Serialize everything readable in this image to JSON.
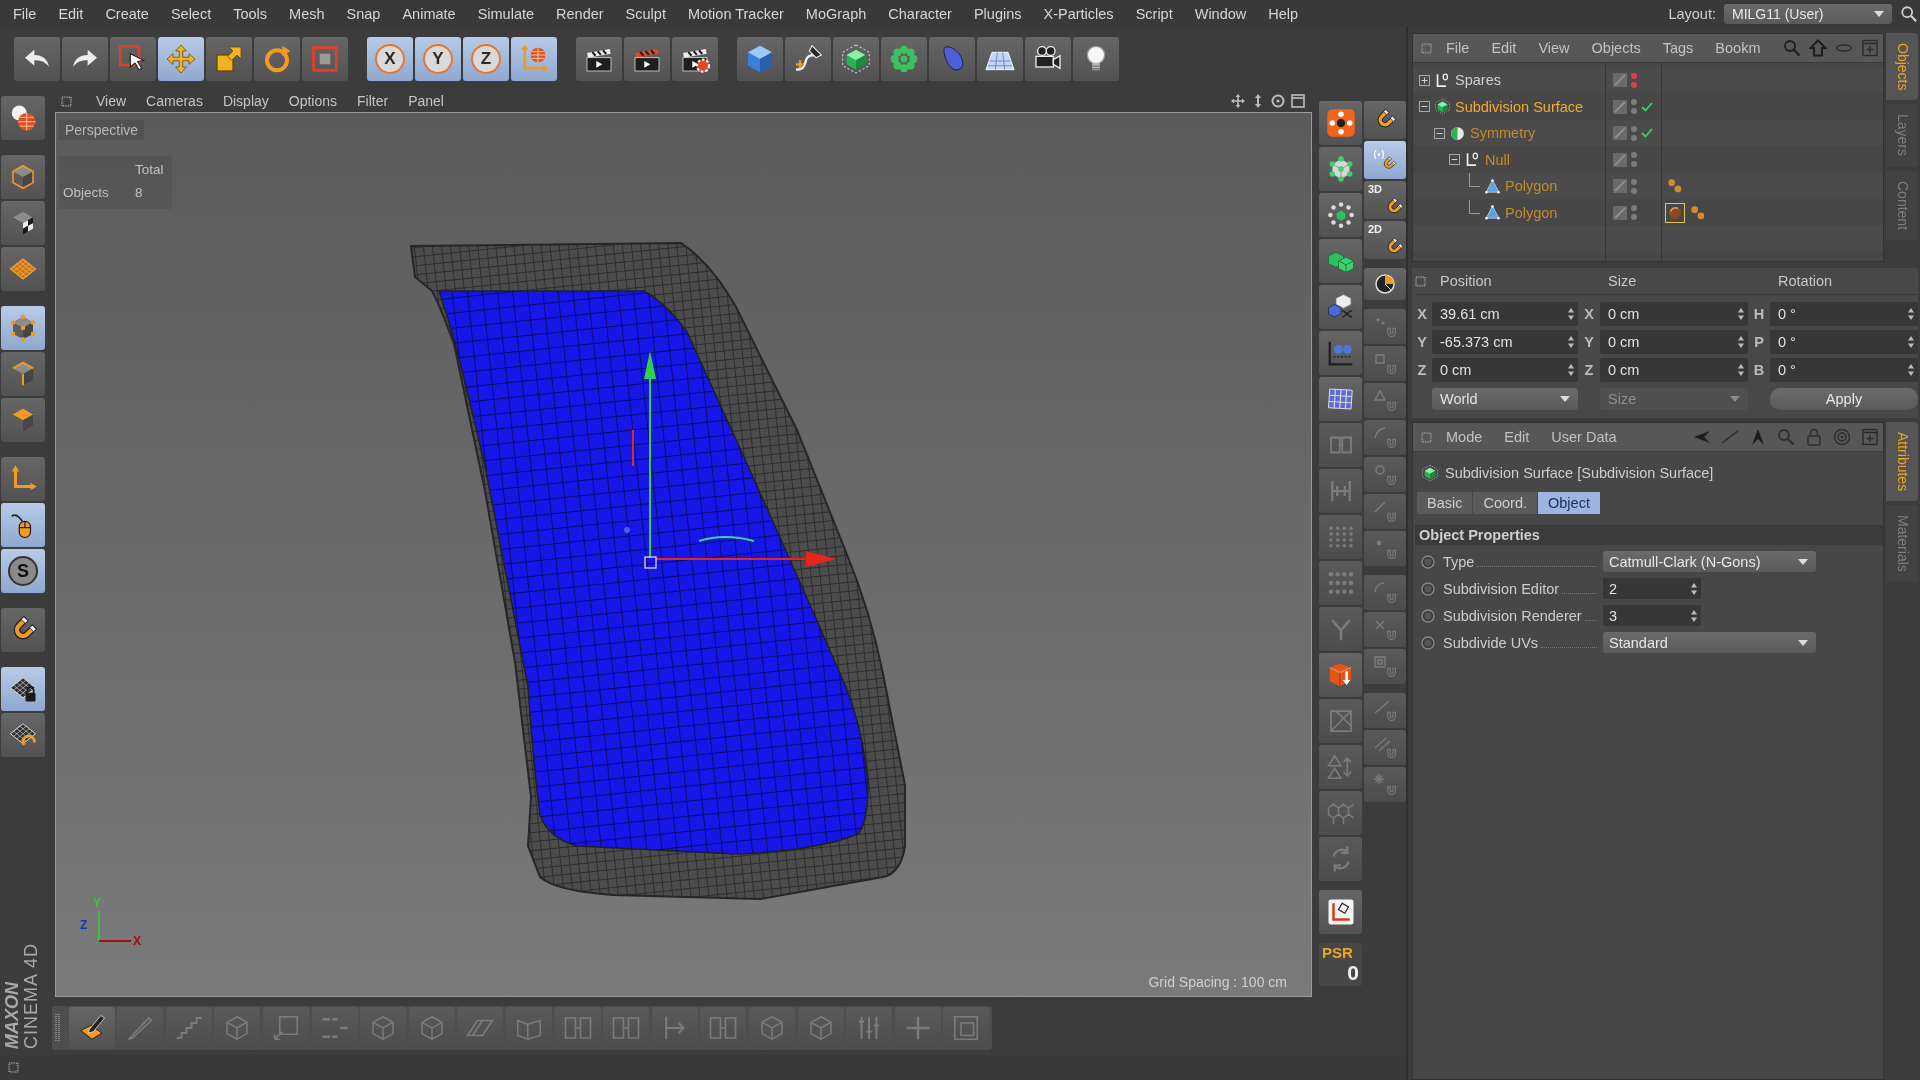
{
  "menu_bar": {
    "items": [
      "File",
      "Edit",
      "Create",
      "Select",
      "Tools",
      "Mesh",
      "Snap",
      "Animate",
      "Simulate",
      "Render",
      "Sculpt",
      "Motion Tracker",
      "MoGraph",
      "Character",
      "Plugins",
      "X-Particles",
      "Script",
      "Window",
      "Help"
    ],
    "layout_label": "Layout:",
    "layout_value": "MILG11 (User)"
  },
  "toolbar": {
    "groups": [
      [
        {
          "kind": "undo",
          "active": false
        },
        {
          "kind": "redo",
          "active": false
        },
        {
          "kind": "select",
          "active": false
        },
        {
          "kind": "move",
          "active": true
        },
        {
          "kind": "scale",
          "active": false
        },
        {
          "kind": "rotate",
          "active": false
        },
        {
          "kind": "recent",
          "active": false
        }
      ],
      [
        {
          "kind": "lock",
          "label": "X",
          "active": true
        },
        {
          "kind": "lock",
          "label": "Y",
          "active": true
        },
        {
          "kind": "lock",
          "label": "Z",
          "active": true
        },
        {
          "kind": "world",
          "active": true
        }
      ],
      [
        {
          "kind": "clapper",
          "active": false
        },
        {
          "kind": "render",
          "active": false
        },
        {
          "kind": "settings",
          "active": false
        }
      ],
      [
        {
          "kind": "cube",
          "active": false
        },
        {
          "kind": "pen",
          "active": false
        },
        {
          "kind": "subdivision",
          "active": false
        },
        {
          "kind": "cloner",
          "active": false
        },
        {
          "kind": "bend",
          "active": false
        },
        {
          "kind": "floor",
          "active": false
        },
        {
          "kind": "camera",
          "active": false
        },
        {
          "kind": "light",
          "active": false
        }
      ]
    ]
  },
  "mode_palette": {
    "groups": [
      [
        {
          "kind": "globe",
          "active": false
        }
      ],
      [
        {
          "kind": "model",
          "active": false
        },
        {
          "kind": "texture",
          "active": false
        },
        {
          "kind": "workplane",
          "active": false
        }
      ],
      [
        {
          "kind": "points",
          "active": true
        },
        {
          "kind": "edges",
          "active": false
        },
        {
          "kind": "polygons",
          "active": false
        }
      ],
      [
        {
          "kind": "axis",
          "active": false
        },
        {
          "kind": "tweak",
          "active": true
        },
        {
          "kind": "solo",
          "label": "S",
          "active": true
        }
      ],
      [
        {
          "kind": "magnet",
          "active": false
        }
      ],
      [
        {
          "kind": "gridlock",
          "active": true
        },
        {
          "kind": "gridrotate",
          "active": false
        }
      ]
    ]
  },
  "brand": {
    "maker": "MAXON",
    "product": "CINEMA 4D"
  },
  "viewport": {
    "menu": [
      "View",
      "Cameras",
      "Display",
      "Options",
      "Filter",
      "Panel"
    ],
    "camera": "Perspective",
    "stats": {
      "header": "Total",
      "rows": [
        {
          "label": "Objects",
          "value": "8"
        }
      ]
    },
    "axes": [
      {
        "label": "Y",
        "color": "#3fbf3f"
      },
      {
        "label": "Z",
        "color": "#1e2ec8"
      },
      {
        "label": "X",
        "color": "#a01010"
      }
    ],
    "grid_spacing": "Grid Spacing : 100 cm"
  },
  "snap_palette": {
    "column_1": {
      "groups": [
        [
          {
            "kind": "crosshair",
            "disabled": false
          },
          {
            "kind": "cubedots",
            "disabled": false
          },
          {
            "kind": "scatter",
            "disabled": false
          },
          {
            "kind": "cubes",
            "disabled": false
          },
          {
            "kind": "shuffle",
            "disabled": false
          },
          {
            "kind": "chart",
            "disabled": false
          },
          {
            "kind": "grid",
            "disabled": false
          },
          {
            "kind": "split",
            "disabled": true
          },
          {
            "kind": "hbars",
            "disabled": true
          },
          {
            "kind": "dots",
            "disabled": true
          },
          {
            "kind": "dotrows",
            "disabled": true
          },
          {
            "kind": "branch",
            "disabled": true
          },
          {
            "kind": "boxarrow",
            "disabled": false
          },
          {
            "kind": "slashbox",
            "disabled": true
          },
          {
            "kind": "triangles",
            "disabled": true
          },
          {
            "kind": "mesh",
            "disabled": true
          },
          {
            "kind": "recycle",
            "disabled": true
          }
        ],
        [
          {
            "kind": "axes",
            "disabled": false
          }
        ]
      ]
    },
    "psr": {
      "label": "PSR",
      "value": "0"
    },
    "column_2": {
      "groups": [
        [
          {
            "kind": "magnet",
            "active": false,
            "disabled": false
          },
          {
            "kind": "magnetdot",
            "active": true,
            "disabled": false
          },
          {
            "kind": "magnet",
            "label": "3D",
            "active": false,
            "disabled": false
          },
          {
            "kind": "magnet",
            "label": "2D",
            "active": false,
            "disabled": false
          }
        ],
        [
          {
            "kind": "pie",
            "active": false,
            "disabled": false
          }
        ],
        [
          {
            "kind": "snapdots",
            "active": false,
            "disabled": true
          },
          {
            "kind": "snapsquare",
            "active": false,
            "disabled": true
          },
          {
            "kind": "snaptri",
            "active": false,
            "disabled": true
          },
          {
            "kind": "snapcurve",
            "active": false,
            "disabled": true
          },
          {
            "kind": "snapring",
            "active": false,
            "disabled": true
          },
          {
            "kind": "snapslash",
            "active": false,
            "disabled": true
          },
          {
            "kind": "snappoint",
            "active": false,
            "disabled": true
          }
        ],
        [
          {
            "kind": "snaparc",
            "active": false,
            "disabled": true
          },
          {
            "kind": "snapcross",
            "active": false,
            "disabled": true
          },
          {
            "kind": "snapframe",
            "active": false,
            "disabled": true
          }
        ],
        [
          {
            "kind": "snapline",
            "active": false,
            "disabled": true
          },
          {
            "kind": "snaplines",
            "active": false,
            "disabled": true
          },
          {
            "kind": "snapstar",
            "active": false,
            "disabled": true
          }
        ]
      ]
    }
  },
  "bottom_toolbar": {
    "items": [
      {
        "kind": "draw",
        "disabled": false
      },
      {
        "kind": "knife",
        "disabled": true
      },
      {
        "kind": "stairs",
        "disabled": true
      },
      {
        "kind": "box",
        "disabled": true
      },
      {
        "kind": "squarearrows",
        "disabled": true
      },
      {
        "kind": "dashes",
        "disabled": true
      },
      {
        "kind": "box",
        "disabled": true
      },
      {
        "kind": "box",
        "disabled": true
      },
      {
        "kind": "flat",
        "disabled": true
      },
      {
        "kind": "fold",
        "disabled": true
      },
      {
        "kind": "bridge",
        "disabled": true
      },
      {
        "kind": "bridge",
        "disabled": true
      },
      {
        "kind": "tee",
        "disabled": true
      },
      {
        "kind": "bridge",
        "disabled": true
      },
      {
        "kind": "box",
        "disabled": true
      },
      {
        "kind": "box",
        "disabled": true
      },
      {
        "kind": "sliders",
        "disabled": true
      },
      {
        "kind": "plus",
        "disabled": true
      },
      {
        "kind": "square",
        "disabled": true
      }
    ]
  },
  "object_manager": {
    "menu": [
      "File",
      "Edit",
      "View",
      "Objects",
      "Tags",
      "Bookm"
    ],
    "objects": [
      {
        "name": "Spares",
        "kind": "null",
        "expanded": false,
        "selected": false,
        "hidden_in_editor": true,
        "hidden_in_render": true,
        "enabled": false
      },
      {
        "name": "Subdivision Surface",
        "kind": "subdivision",
        "expanded": true,
        "selected": true,
        "hidden_in_editor": false,
        "hidden_in_render": false,
        "enabled": true,
        "children": [
          {
            "name": "Symmetry",
            "kind": "symmetry",
            "expanded": true,
            "selected": false,
            "hidden_in_editor": false,
            "hidden_in_render": false,
            "enabled": true,
            "children": [
              {
                "name": "Null",
                "kind": "null",
                "expanded": true,
                "selected": false,
                "hidden_in_editor": false,
                "hidden_in_render": false,
                "enabled": false,
                "children": [
                  {
                    "name": "Polygon",
                    "kind": "polygon",
                    "selected": false,
                    "hidden_in_editor": false,
                    "hidden_in_render": false,
                    "enabled": false,
                    "tags": [
                      {
                        "kind": "points",
                        "selected": false
                      }
                    ]
                  },
                  {
                    "name": "Polygon",
                    "kind": "polygon",
                    "selected": false,
                    "hidden_in_editor": false,
                    "hidden_in_render": false,
                    "enabled": false,
                    "tags": [
                      {
                        "kind": "material",
                        "selected": true
                      },
                      {
                        "kind": "points",
                        "selected": false
                      }
                    ]
                  }
                ]
              }
            ]
          }
        ]
      }
    ],
    "tabs": [
      {
        "label": "Objects",
        "selected": true
      },
      {
        "label": "Layers",
        "selected": false
      },
      {
        "label": "Content",
        "selected": false
      }
    ]
  },
  "coordinates": {
    "columns": [
      {
        "header": "Position",
        "fields": [
          {
            "axis": "X",
            "value": "39.61 cm"
          },
          {
            "axis": "Y",
            "value": "-65.373 cm"
          },
          {
            "axis": "Z",
            "value": "0 cm"
          }
        ]
      },
      {
        "header": "Size",
        "fields": [
          {
            "axis": "X",
            "value": "0 cm"
          },
          {
            "axis": "Y",
            "value": "0 cm"
          },
          {
            "axis": "Z",
            "value": "0 cm"
          }
        ]
      },
      {
        "header": "Rotation",
        "fields": [
          {
            "axis": "H",
            "value": "0 °"
          },
          {
            "axis": "P",
            "value": "0 °"
          },
          {
            "axis": "B",
            "value": "0 °"
          }
        ]
      }
    ],
    "mode": "World",
    "size_mode": {
      "label": "Size",
      "disabled": true
    },
    "apply": "Apply"
  },
  "attributes": {
    "menu": [
      "Mode",
      "Edit",
      "User Data"
    ],
    "title": "Subdivision Surface [Subdivision Surface]",
    "tabs": [
      {
        "label": "Basic",
        "selected": false
      },
      {
        "label": "Coord.",
        "selected": false
      },
      {
        "label": "Object",
        "selected": true
      }
    ],
    "section": "Object Properties",
    "params": [
      {
        "kind": "dropdown",
        "label": "Type",
        "value": "Catmull-Clark (N-Gons)"
      },
      {
        "kind": "number",
        "label": "Subdivision Editor",
        "value": "2"
      },
      {
        "kind": "number",
        "label": "Subdivision Renderer",
        "value": "3"
      },
      {
        "kind": "dropdown",
        "label": "Subdivide UVs",
        "value": "Standard"
      }
    ],
    "side_tabs": [
      {
        "label": "Attributes",
        "selected": true
      },
      {
        "label": "Materials",
        "selected": false
      }
    ]
  }
}
